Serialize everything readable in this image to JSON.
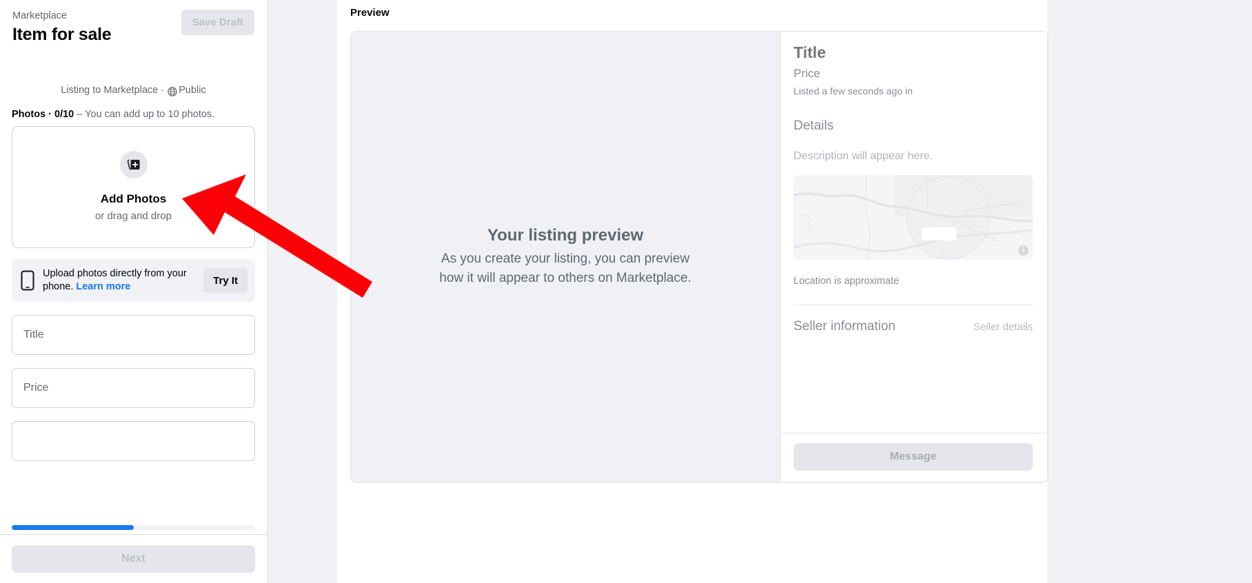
{
  "sidebar": {
    "breadcrumb": "Marketplace",
    "page_title": "Item for sale",
    "save_draft_label": "Save Draft",
    "listing_to_prefix": "Listing to Marketplace · ",
    "audience": "Public",
    "photos_label_bold": "Photos · 0/10",
    "photos_label_rest": " – You can add up to 10 photos.",
    "dropzone": {
      "title": "Add Photos",
      "subtitle": "or drag and drop"
    },
    "phone_banner": {
      "text": "Upload photos directly from your phone. ",
      "link": "Learn more",
      "button_label": "Try It"
    },
    "fields": [
      {
        "name": "title",
        "placeholder": "Title",
        "value": ""
      },
      {
        "name": "price",
        "placeholder": "Price",
        "value": ""
      }
    ],
    "progress_percent": 50,
    "next_label": "Next"
  },
  "preview": {
    "heading": "Preview",
    "empty_title": "Your listing preview",
    "empty_subtitle": "As you create your listing, you can preview\nhow it will appear to others on Marketplace.",
    "card": {
      "title": "Title",
      "price": "Price",
      "listed": "Listed a few seconds ago in",
      "details_heading": "Details",
      "description": "Description will appear here.",
      "map_info_glyph": "i",
      "location_note": "Location is approximate",
      "seller_heading": "Seller information",
      "seller_details": "Seller details",
      "message_label": "Message"
    }
  },
  "colors": {
    "accent_blue": "#1877f2",
    "annotation_red": "#fd0005",
    "page_bg": "#f0f2f5",
    "disabled_bg": "#e4e6eb"
  }
}
